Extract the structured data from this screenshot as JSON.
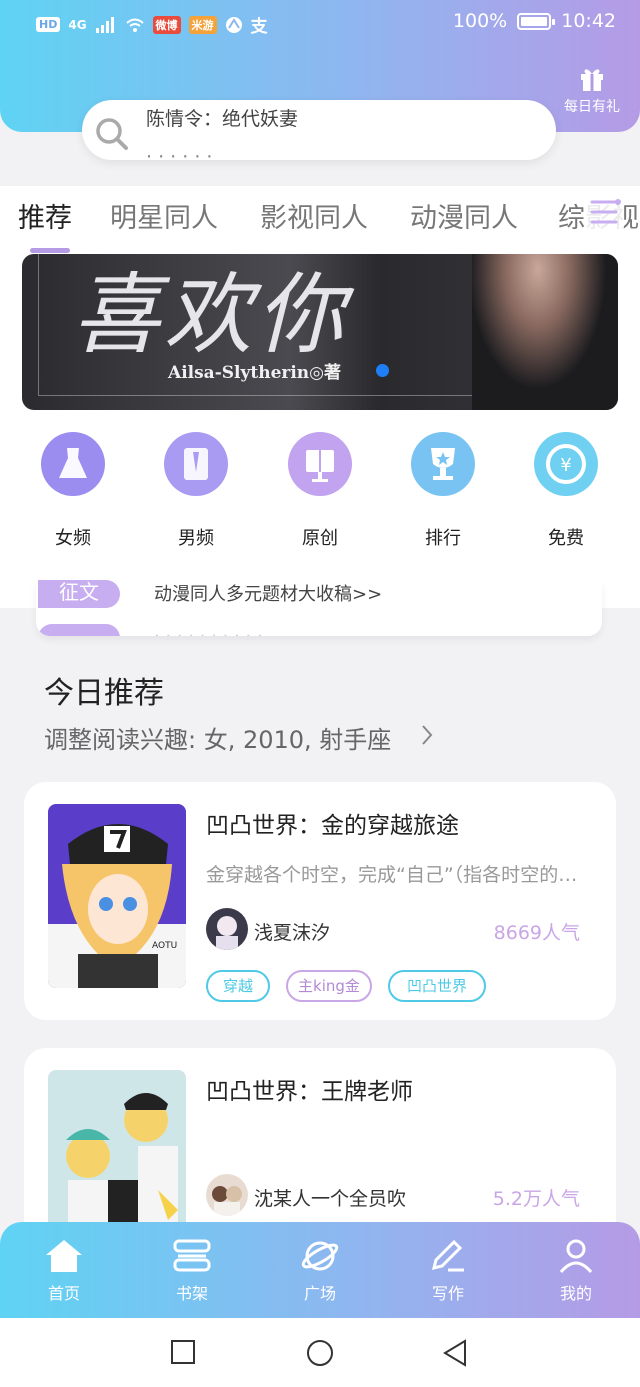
{
  "status_bar": {
    "left_chips": [
      "HD",
      "4G"
    ],
    "app_chips": [
      "微博",
      "米游"
    ],
    "alipay": "支",
    "battery": "100%",
    "time": "10:42"
  },
  "header": {
    "gift_label": "每日有礼",
    "search_text": "陈情令：绝代妖妻"
  },
  "tabs": [
    "推荐",
    "明星同人",
    "影视同人",
    "动漫同人",
    "综影视"
  ],
  "active_tab": 0,
  "banner": {
    "title": "喜欢你",
    "author": "Ailsa-Slytherin◎著"
  },
  "categories": [
    {
      "label": "女频",
      "icon": "dress-icon",
      "color": "#9b8df0"
    },
    {
      "label": "男频",
      "icon": "shirt-icon",
      "color": "#a99af2"
    },
    {
      "label": "原创",
      "icon": "book-icon",
      "color": "#c2a3f0"
    },
    {
      "label": "排行",
      "icon": "trophy-icon",
      "color": "#79c3f2"
    },
    {
      "label": "免费",
      "icon": "coin-icon",
      "color": "#6fd0f2"
    }
  ],
  "notice": {
    "badge": "征文",
    "text": "动漫同人多元题材大收稿>>"
  },
  "today": {
    "title": "今日推荐",
    "subtitle": "调整阅读兴趣: 女, 2010, 射手座"
  },
  "books": [
    {
      "title": "凹凸世界：金的穿越旅途",
      "desc": "金穿越各个时空，完成“自己”（指各时空的金）的心愿",
      "author": "浅夏沫汐",
      "popularity": "8669人气",
      "tags": [
        "穿越",
        "主king金",
        "凹凸世界"
      ],
      "cover_text": "AOTU"
    },
    {
      "title": "凹凸世界：王牌老师",
      "desc": "",
      "author": "沈某人一个全员吹",
      "popularity": "5.2万人气",
      "tags": []
    }
  ],
  "bottom_nav": [
    {
      "label": "首页",
      "icon": "home-icon"
    },
    {
      "label": "书架",
      "icon": "bookshelf-icon"
    },
    {
      "label": "广场",
      "icon": "planet-icon"
    },
    {
      "label": "写作",
      "icon": "pen-icon"
    },
    {
      "label": "我的",
      "icon": "user-icon"
    }
  ],
  "colors": {
    "gradient_start": "#5fd3f3",
    "gradient_end": "#b59be6",
    "accent_purple": "#b59be6",
    "popularity": "#c9a6e6",
    "tag_cyan": "#4ec9e6",
    "tag_purple": "#c9a6e6"
  }
}
